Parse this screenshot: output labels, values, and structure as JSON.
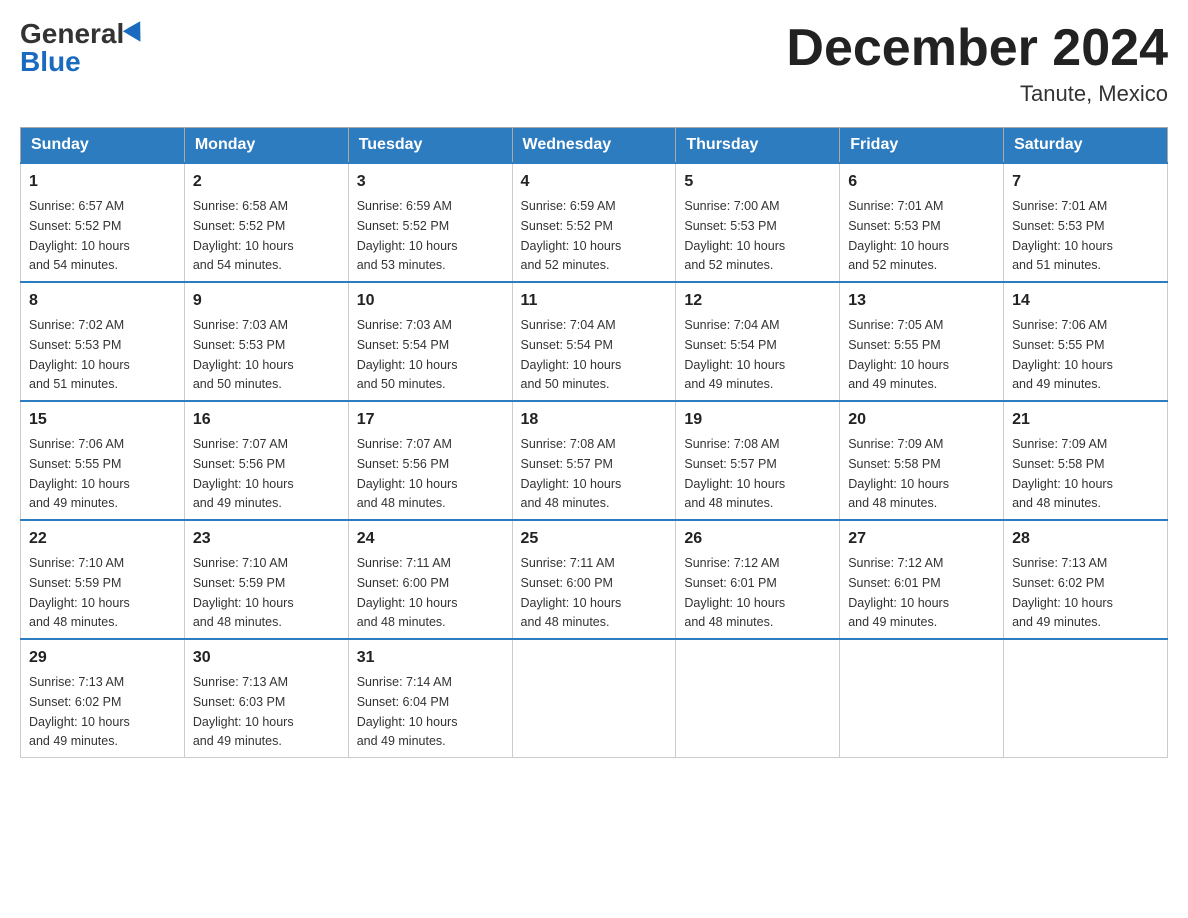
{
  "header": {
    "logo_general": "General",
    "logo_blue": "Blue",
    "month_title": "December 2024",
    "location": "Tanute, Mexico"
  },
  "weekdays": [
    "Sunday",
    "Monday",
    "Tuesday",
    "Wednesday",
    "Thursday",
    "Friday",
    "Saturday"
  ],
  "weeks": [
    [
      {
        "day": "1",
        "sunrise": "6:57 AM",
        "sunset": "5:52 PM",
        "daylight": "10 hours and 54 minutes."
      },
      {
        "day": "2",
        "sunrise": "6:58 AM",
        "sunset": "5:52 PM",
        "daylight": "10 hours and 54 minutes."
      },
      {
        "day": "3",
        "sunrise": "6:59 AM",
        "sunset": "5:52 PM",
        "daylight": "10 hours and 53 minutes."
      },
      {
        "day": "4",
        "sunrise": "6:59 AM",
        "sunset": "5:52 PM",
        "daylight": "10 hours and 52 minutes."
      },
      {
        "day": "5",
        "sunrise": "7:00 AM",
        "sunset": "5:53 PM",
        "daylight": "10 hours and 52 minutes."
      },
      {
        "day": "6",
        "sunrise": "7:01 AM",
        "sunset": "5:53 PM",
        "daylight": "10 hours and 52 minutes."
      },
      {
        "day": "7",
        "sunrise": "7:01 AM",
        "sunset": "5:53 PM",
        "daylight": "10 hours and 51 minutes."
      }
    ],
    [
      {
        "day": "8",
        "sunrise": "7:02 AM",
        "sunset": "5:53 PM",
        "daylight": "10 hours and 51 minutes."
      },
      {
        "day": "9",
        "sunrise": "7:03 AM",
        "sunset": "5:53 PM",
        "daylight": "10 hours and 50 minutes."
      },
      {
        "day": "10",
        "sunrise": "7:03 AM",
        "sunset": "5:54 PM",
        "daylight": "10 hours and 50 minutes."
      },
      {
        "day": "11",
        "sunrise": "7:04 AM",
        "sunset": "5:54 PM",
        "daylight": "10 hours and 50 minutes."
      },
      {
        "day": "12",
        "sunrise": "7:04 AM",
        "sunset": "5:54 PM",
        "daylight": "10 hours and 49 minutes."
      },
      {
        "day": "13",
        "sunrise": "7:05 AM",
        "sunset": "5:55 PM",
        "daylight": "10 hours and 49 minutes."
      },
      {
        "day": "14",
        "sunrise": "7:06 AM",
        "sunset": "5:55 PM",
        "daylight": "10 hours and 49 minutes."
      }
    ],
    [
      {
        "day": "15",
        "sunrise": "7:06 AM",
        "sunset": "5:55 PM",
        "daylight": "10 hours and 49 minutes."
      },
      {
        "day": "16",
        "sunrise": "7:07 AM",
        "sunset": "5:56 PM",
        "daylight": "10 hours and 49 minutes."
      },
      {
        "day": "17",
        "sunrise": "7:07 AM",
        "sunset": "5:56 PM",
        "daylight": "10 hours and 48 minutes."
      },
      {
        "day": "18",
        "sunrise": "7:08 AM",
        "sunset": "5:57 PM",
        "daylight": "10 hours and 48 minutes."
      },
      {
        "day": "19",
        "sunrise": "7:08 AM",
        "sunset": "5:57 PM",
        "daylight": "10 hours and 48 minutes."
      },
      {
        "day": "20",
        "sunrise": "7:09 AM",
        "sunset": "5:58 PM",
        "daylight": "10 hours and 48 minutes."
      },
      {
        "day": "21",
        "sunrise": "7:09 AM",
        "sunset": "5:58 PM",
        "daylight": "10 hours and 48 minutes."
      }
    ],
    [
      {
        "day": "22",
        "sunrise": "7:10 AM",
        "sunset": "5:59 PM",
        "daylight": "10 hours and 48 minutes."
      },
      {
        "day": "23",
        "sunrise": "7:10 AM",
        "sunset": "5:59 PM",
        "daylight": "10 hours and 48 minutes."
      },
      {
        "day": "24",
        "sunrise": "7:11 AM",
        "sunset": "6:00 PM",
        "daylight": "10 hours and 48 minutes."
      },
      {
        "day": "25",
        "sunrise": "7:11 AM",
        "sunset": "6:00 PM",
        "daylight": "10 hours and 48 minutes."
      },
      {
        "day": "26",
        "sunrise": "7:12 AM",
        "sunset": "6:01 PM",
        "daylight": "10 hours and 48 minutes."
      },
      {
        "day": "27",
        "sunrise": "7:12 AM",
        "sunset": "6:01 PM",
        "daylight": "10 hours and 49 minutes."
      },
      {
        "day": "28",
        "sunrise": "7:13 AM",
        "sunset": "6:02 PM",
        "daylight": "10 hours and 49 minutes."
      }
    ],
    [
      {
        "day": "29",
        "sunrise": "7:13 AM",
        "sunset": "6:02 PM",
        "daylight": "10 hours and 49 minutes."
      },
      {
        "day": "30",
        "sunrise": "7:13 AM",
        "sunset": "6:03 PM",
        "daylight": "10 hours and 49 minutes."
      },
      {
        "day": "31",
        "sunrise": "7:14 AM",
        "sunset": "6:04 PM",
        "daylight": "10 hours and 49 minutes."
      },
      null,
      null,
      null,
      null
    ]
  ],
  "labels": {
    "sunrise": "Sunrise:",
    "sunset": "Sunset:",
    "daylight": "Daylight:"
  }
}
